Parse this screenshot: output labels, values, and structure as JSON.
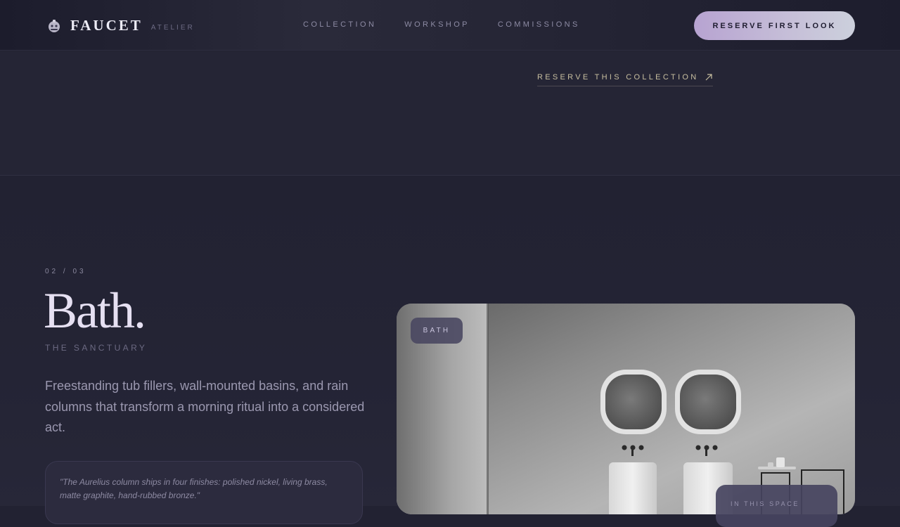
{
  "header": {
    "brand_name": "FAUCET",
    "brand_tagline": "ATELIER",
    "brand_icon": "faucet-icon",
    "nav": [
      {
        "label": "COLLECTION"
      },
      {
        "label": "WORKSHOP"
      },
      {
        "label": "COMMISSIONS"
      }
    ],
    "cta_label": "RESERVE FIRST LOOK"
  },
  "band": {
    "reserve_link": "RESERVE THIS COLLECTION",
    "reserve_icon": "arrow-up-right-icon"
  },
  "section": {
    "counter": "02 / 03",
    "title": "Bath.",
    "subtitle": "THE SANCTUARY",
    "description": "Freestanding tub fillers, wall-mounted basins, and rain columns that transform a morning ritual into a considered act.",
    "quote": "\"The Aurelius column ships in four finishes: polished nickel, living brass, matte graphite, hand-rubbed bronze.\"",
    "image_chip": "BATH",
    "space_label": "IN THIS SPACE"
  },
  "colors": {
    "background": "#222232",
    "accent": "#b7a3d1",
    "link": "#c8bfa0"
  }
}
